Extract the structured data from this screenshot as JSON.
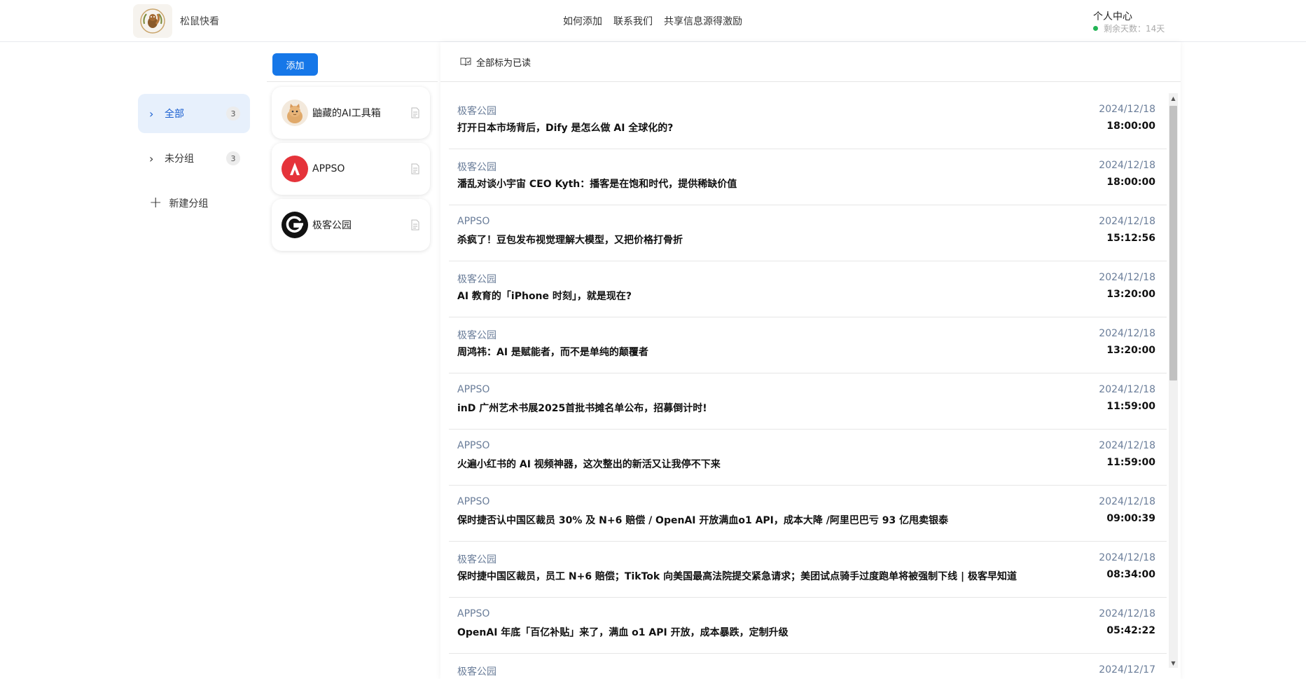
{
  "header": {
    "brand": "松鼠快看",
    "nav": [
      "如何添加",
      "联系我们",
      "共享信息源得激励"
    ],
    "user_center": "个人中心",
    "remaining": "剩余天数：14天",
    "status_color": "#22b455"
  },
  "groups": [
    {
      "label": "全部",
      "count": "3",
      "active": true
    },
    {
      "label": "未分组",
      "count": "3",
      "active": false
    }
  ],
  "new_group_label": "新建分组",
  "add_button": "添加",
  "sources": [
    {
      "name": "鼬藏的AI工具箱",
      "icon": "cat-avatar-icon"
    },
    {
      "name": "APPSO",
      "icon": "appso-logo-icon"
    },
    {
      "name": "极客公园",
      "icon": "geekpark-logo-icon"
    }
  ],
  "mark_all_read": "全部标为已读",
  "articles": [
    {
      "source": "极客公园",
      "title": "打开日本市场背后，Dify 是怎么做 AI 全球化的?",
      "date": "2024/12/18",
      "time": "18:00:00"
    },
    {
      "source": "极客公园",
      "title": "潘乱对谈小宇宙 CEO Kyth：播客是在饱和时代，提供稀缺价值",
      "date": "2024/12/18",
      "time": "18:00:00"
    },
    {
      "source": "APPSO",
      "title": "杀疯了！豆包发布视觉理解大模型，又把价格打骨折",
      "date": "2024/12/18",
      "time": "15:12:56"
    },
    {
      "source": "极客公园",
      "title": "AI 教育的「iPhone 时刻」，就是现在?",
      "date": "2024/12/18",
      "time": "13:20:00"
    },
    {
      "source": "极客公园",
      "title": "周鸿祎：AI 是赋能者，而不是单纯的颠覆者",
      "date": "2024/12/18",
      "time": "13:20:00"
    },
    {
      "source": "APPSO",
      "title": "inD 广州艺术书展2025首批书摊名单公布，招募倒计时!",
      "date": "2024/12/18",
      "time": "11:59:00"
    },
    {
      "source": "APPSO",
      "title": "火遍小红书的 AI 视频神器，这次整出的新活又让我停不下来",
      "date": "2024/12/18",
      "time": "11:59:00"
    },
    {
      "source": "APPSO",
      "title": "保时捷否认中国区裁员 30% 及 N+6 赔偿 / OpenAI 开放满血o1 API，成本大降 /阿里巴巴亏 93 亿甩卖银泰",
      "date": "2024/12/18",
      "time": "09:00:39"
    },
    {
      "source": "极客公园",
      "title": "保时捷中国区裁员，员工 N+6 赔偿；TikTok 向美国最高法院提交紧急请求；美团试点骑手过度跑单将被强制下线 | 极客早知道",
      "date": "2024/12/18",
      "time": "08:34:00"
    },
    {
      "source": "APPSO",
      "title": "OpenAI 年底「百亿补贴」来了，满血 o1 API 开放，成本暴跌，定制升级",
      "date": "2024/12/18",
      "time": "05:42:22"
    },
    {
      "source": "极客公园",
      "title": "",
      "date": "2024/12/17",
      "time": ""
    }
  ]
}
